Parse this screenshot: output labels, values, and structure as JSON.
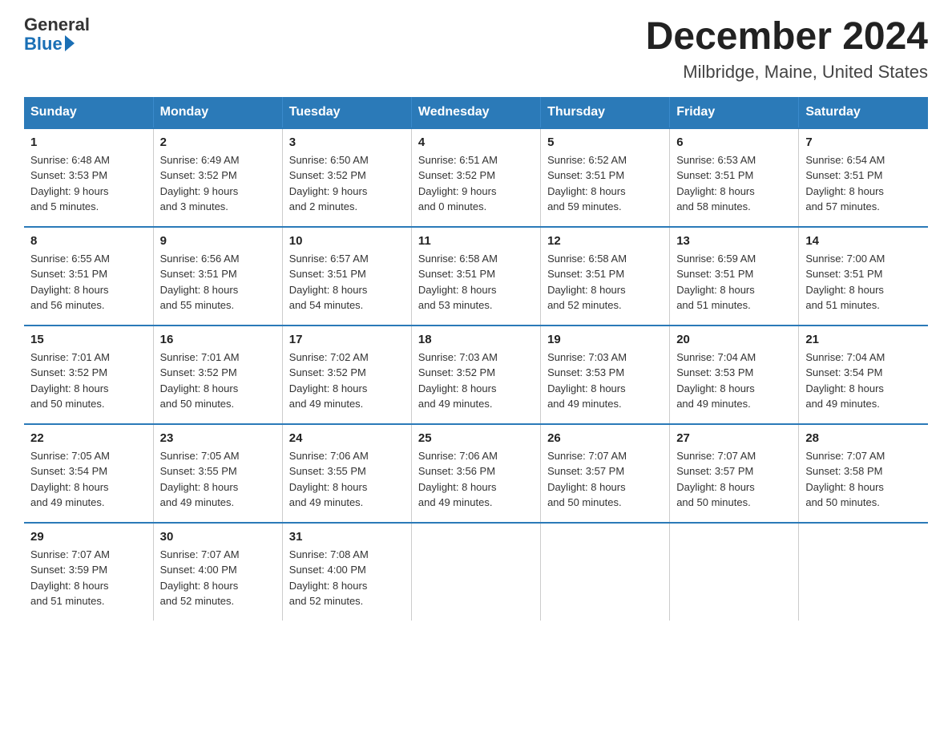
{
  "header": {
    "logo_general": "General",
    "logo_blue": "Blue",
    "month_title": "December 2024",
    "location": "Milbridge, Maine, United States"
  },
  "weekdays": [
    "Sunday",
    "Monday",
    "Tuesday",
    "Wednesday",
    "Thursday",
    "Friday",
    "Saturday"
  ],
  "weeks": [
    [
      {
        "day": "1",
        "sunrise": "6:48 AM",
        "sunset": "3:53 PM",
        "daylight": "9 hours and 5 minutes."
      },
      {
        "day": "2",
        "sunrise": "6:49 AM",
        "sunset": "3:52 PM",
        "daylight": "9 hours and 3 minutes."
      },
      {
        "day": "3",
        "sunrise": "6:50 AM",
        "sunset": "3:52 PM",
        "daylight": "9 hours and 2 minutes."
      },
      {
        "day": "4",
        "sunrise": "6:51 AM",
        "sunset": "3:52 PM",
        "daylight": "9 hours and 0 minutes."
      },
      {
        "day": "5",
        "sunrise": "6:52 AM",
        "sunset": "3:51 PM",
        "daylight": "8 hours and 59 minutes."
      },
      {
        "day": "6",
        "sunrise": "6:53 AM",
        "sunset": "3:51 PM",
        "daylight": "8 hours and 58 minutes."
      },
      {
        "day": "7",
        "sunrise": "6:54 AM",
        "sunset": "3:51 PM",
        "daylight": "8 hours and 57 minutes."
      }
    ],
    [
      {
        "day": "8",
        "sunrise": "6:55 AM",
        "sunset": "3:51 PM",
        "daylight": "8 hours and 56 minutes."
      },
      {
        "day": "9",
        "sunrise": "6:56 AM",
        "sunset": "3:51 PM",
        "daylight": "8 hours and 55 minutes."
      },
      {
        "day": "10",
        "sunrise": "6:57 AM",
        "sunset": "3:51 PM",
        "daylight": "8 hours and 54 minutes."
      },
      {
        "day": "11",
        "sunrise": "6:58 AM",
        "sunset": "3:51 PM",
        "daylight": "8 hours and 53 minutes."
      },
      {
        "day": "12",
        "sunrise": "6:58 AM",
        "sunset": "3:51 PM",
        "daylight": "8 hours and 52 minutes."
      },
      {
        "day": "13",
        "sunrise": "6:59 AM",
        "sunset": "3:51 PM",
        "daylight": "8 hours and 51 minutes."
      },
      {
        "day": "14",
        "sunrise": "7:00 AM",
        "sunset": "3:51 PM",
        "daylight": "8 hours and 51 minutes."
      }
    ],
    [
      {
        "day": "15",
        "sunrise": "7:01 AM",
        "sunset": "3:52 PM",
        "daylight": "8 hours and 50 minutes."
      },
      {
        "day": "16",
        "sunrise": "7:01 AM",
        "sunset": "3:52 PM",
        "daylight": "8 hours and 50 minutes."
      },
      {
        "day": "17",
        "sunrise": "7:02 AM",
        "sunset": "3:52 PM",
        "daylight": "8 hours and 49 minutes."
      },
      {
        "day": "18",
        "sunrise": "7:03 AM",
        "sunset": "3:52 PM",
        "daylight": "8 hours and 49 minutes."
      },
      {
        "day": "19",
        "sunrise": "7:03 AM",
        "sunset": "3:53 PM",
        "daylight": "8 hours and 49 minutes."
      },
      {
        "day": "20",
        "sunrise": "7:04 AM",
        "sunset": "3:53 PM",
        "daylight": "8 hours and 49 minutes."
      },
      {
        "day": "21",
        "sunrise": "7:04 AM",
        "sunset": "3:54 PM",
        "daylight": "8 hours and 49 minutes."
      }
    ],
    [
      {
        "day": "22",
        "sunrise": "7:05 AM",
        "sunset": "3:54 PM",
        "daylight": "8 hours and 49 minutes."
      },
      {
        "day": "23",
        "sunrise": "7:05 AM",
        "sunset": "3:55 PM",
        "daylight": "8 hours and 49 minutes."
      },
      {
        "day": "24",
        "sunrise": "7:06 AM",
        "sunset": "3:55 PM",
        "daylight": "8 hours and 49 minutes."
      },
      {
        "day": "25",
        "sunrise": "7:06 AM",
        "sunset": "3:56 PM",
        "daylight": "8 hours and 49 minutes."
      },
      {
        "day": "26",
        "sunrise": "7:07 AM",
        "sunset": "3:57 PM",
        "daylight": "8 hours and 50 minutes."
      },
      {
        "day": "27",
        "sunrise": "7:07 AM",
        "sunset": "3:57 PM",
        "daylight": "8 hours and 50 minutes."
      },
      {
        "day": "28",
        "sunrise": "7:07 AM",
        "sunset": "3:58 PM",
        "daylight": "8 hours and 50 minutes."
      }
    ],
    [
      {
        "day": "29",
        "sunrise": "7:07 AM",
        "sunset": "3:59 PM",
        "daylight": "8 hours and 51 minutes."
      },
      {
        "day": "30",
        "sunrise": "7:07 AM",
        "sunset": "4:00 PM",
        "daylight": "8 hours and 52 minutes."
      },
      {
        "day": "31",
        "sunrise": "7:08 AM",
        "sunset": "4:00 PM",
        "daylight": "8 hours and 52 minutes."
      },
      null,
      null,
      null,
      null
    ]
  ],
  "labels": {
    "sunrise": "Sunrise:",
    "sunset": "Sunset:",
    "daylight": "Daylight:"
  }
}
